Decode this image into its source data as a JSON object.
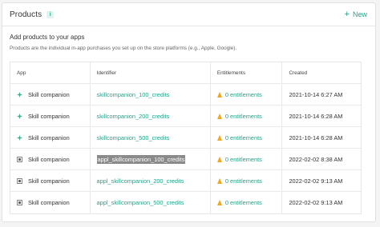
{
  "header": {
    "title": "Products",
    "info_icon": "i",
    "new_label": "New"
  },
  "section": {
    "title": "Add products to your apps",
    "subtitle": "Products are the individual in-app purchases you set up on the store platforms (e.g., Apple, Google)."
  },
  "table": {
    "columns": [
      "App",
      "Identifier",
      "Entitlements",
      "Created"
    ],
    "rows": [
      {
        "app": "Skill companion",
        "platform": "android",
        "identifier": "skillcompanion_100_credits",
        "entitlements": "0 entitlements",
        "created": "2021-10-14 6:27 AM"
      },
      {
        "app": "Skill companion",
        "platform": "android",
        "identifier": "skillcompanion_200_credits",
        "entitlements": "0 entitlements",
        "created": "2021-10-14 6:28 AM"
      },
      {
        "app": "Skill companion",
        "platform": "android",
        "identifier": "skillcompanion_500_credits",
        "entitlements": "0 entitlements",
        "created": "2021-10-14 6:28 AM"
      },
      {
        "app": "Skill companion",
        "platform": "apple",
        "identifier": "appl_skillcompanion_100_credits",
        "entitlements": "0 entitlements",
        "created": "2022-02-02 8:38 AM",
        "selected": true
      },
      {
        "app": "Skill companion",
        "platform": "apple",
        "identifier": "appl_skillcompanion_200_credits",
        "entitlements": "0 entitlements",
        "created": "2022-02-02 9:13 AM"
      },
      {
        "app": "Skill companion",
        "platform": "apple",
        "identifier": "appl_skillcompanion_500_credits",
        "entitlements": "0 entitlements",
        "created": "2022-02-02 9:13 AM"
      }
    ]
  },
  "colors": {
    "accent": "#21a38a",
    "warning": "#f2a81d",
    "android": "#3bb08f",
    "apple": "#555555"
  }
}
